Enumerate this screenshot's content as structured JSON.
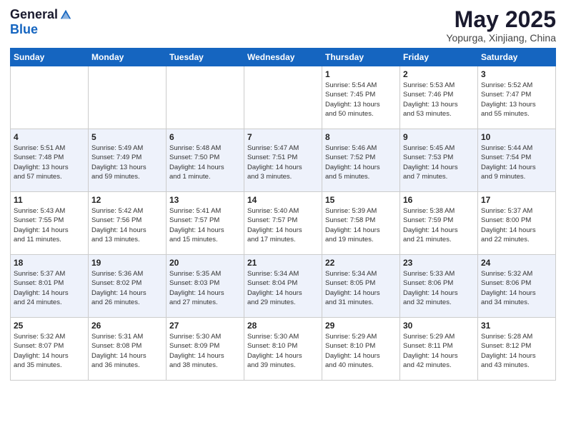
{
  "logo": {
    "general": "General",
    "blue": "Blue"
  },
  "title": "May 2025",
  "location": "Yopurga, Xinjiang, China",
  "days_of_week": [
    "Sunday",
    "Monday",
    "Tuesday",
    "Wednesday",
    "Thursday",
    "Friday",
    "Saturday"
  ],
  "weeks": [
    [
      {
        "day": "",
        "info": ""
      },
      {
        "day": "",
        "info": ""
      },
      {
        "day": "",
        "info": ""
      },
      {
        "day": "",
        "info": ""
      },
      {
        "day": "1",
        "info": "Sunrise: 5:54 AM\nSunset: 7:45 PM\nDaylight: 13 hours\nand 50 minutes."
      },
      {
        "day": "2",
        "info": "Sunrise: 5:53 AM\nSunset: 7:46 PM\nDaylight: 13 hours\nand 53 minutes."
      },
      {
        "day": "3",
        "info": "Sunrise: 5:52 AM\nSunset: 7:47 PM\nDaylight: 13 hours\nand 55 minutes."
      }
    ],
    [
      {
        "day": "4",
        "info": "Sunrise: 5:51 AM\nSunset: 7:48 PM\nDaylight: 13 hours\nand 57 minutes."
      },
      {
        "day": "5",
        "info": "Sunrise: 5:49 AM\nSunset: 7:49 PM\nDaylight: 13 hours\nand 59 minutes."
      },
      {
        "day": "6",
        "info": "Sunrise: 5:48 AM\nSunset: 7:50 PM\nDaylight: 14 hours\nand 1 minute."
      },
      {
        "day": "7",
        "info": "Sunrise: 5:47 AM\nSunset: 7:51 PM\nDaylight: 14 hours\nand 3 minutes."
      },
      {
        "day": "8",
        "info": "Sunrise: 5:46 AM\nSunset: 7:52 PM\nDaylight: 14 hours\nand 5 minutes."
      },
      {
        "day": "9",
        "info": "Sunrise: 5:45 AM\nSunset: 7:53 PM\nDaylight: 14 hours\nand 7 minutes."
      },
      {
        "day": "10",
        "info": "Sunrise: 5:44 AM\nSunset: 7:54 PM\nDaylight: 14 hours\nand 9 minutes."
      }
    ],
    [
      {
        "day": "11",
        "info": "Sunrise: 5:43 AM\nSunset: 7:55 PM\nDaylight: 14 hours\nand 11 minutes."
      },
      {
        "day": "12",
        "info": "Sunrise: 5:42 AM\nSunset: 7:56 PM\nDaylight: 14 hours\nand 13 minutes."
      },
      {
        "day": "13",
        "info": "Sunrise: 5:41 AM\nSunset: 7:57 PM\nDaylight: 14 hours\nand 15 minutes."
      },
      {
        "day": "14",
        "info": "Sunrise: 5:40 AM\nSunset: 7:57 PM\nDaylight: 14 hours\nand 17 minutes."
      },
      {
        "day": "15",
        "info": "Sunrise: 5:39 AM\nSunset: 7:58 PM\nDaylight: 14 hours\nand 19 minutes."
      },
      {
        "day": "16",
        "info": "Sunrise: 5:38 AM\nSunset: 7:59 PM\nDaylight: 14 hours\nand 21 minutes."
      },
      {
        "day": "17",
        "info": "Sunrise: 5:37 AM\nSunset: 8:00 PM\nDaylight: 14 hours\nand 22 minutes."
      }
    ],
    [
      {
        "day": "18",
        "info": "Sunrise: 5:37 AM\nSunset: 8:01 PM\nDaylight: 14 hours\nand 24 minutes."
      },
      {
        "day": "19",
        "info": "Sunrise: 5:36 AM\nSunset: 8:02 PM\nDaylight: 14 hours\nand 26 minutes."
      },
      {
        "day": "20",
        "info": "Sunrise: 5:35 AM\nSunset: 8:03 PM\nDaylight: 14 hours\nand 27 minutes."
      },
      {
        "day": "21",
        "info": "Sunrise: 5:34 AM\nSunset: 8:04 PM\nDaylight: 14 hours\nand 29 minutes."
      },
      {
        "day": "22",
        "info": "Sunrise: 5:34 AM\nSunset: 8:05 PM\nDaylight: 14 hours\nand 31 minutes."
      },
      {
        "day": "23",
        "info": "Sunrise: 5:33 AM\nSunset: 8:06 PM\nDaylight: 14 hours\nand 32 minutes."
      },
      {
        "day": "24",
        "info": "Sunrise: 5:32 AM\nSunset: 8:06 PM\nDaylight: 14 hours\nand 34 minutes."
      }
    ],
    [
      {
        "day": "25",
        "info": "Sunrise: 5:32 AM\nSunset: 8:07 PM\nDaylight: 14 hours\nand 35 minutes."
      },
      {
        "day": "26",
        "info": "Sunrise: 5:31 AM\nSunset: 8:08 PM\nDaylight: 14 hours\nand 36 minutes."
      },
      {
        "day": "27",
        "info": "Sunrise: 5:30 AM\nSunset: 8:09 PM\nDaylight: 14 hours\nand 38 minutes."
      },
      {
        "day": "28",
        "info": "Sunrise: 5:30 AM\nSunset: 8:10 PM\nDaylight: 14 hours\nand 39 minutes."
      },
      {
        "day": "29",
        "info": "Sunrise: 5:29 AM\nSunset: 8:10 PM\nDaylight: 14 hours\nand 40 minutes."
      },
      {
        "day": "30",
        "info": "Sunrise: 5:29 AM\nSunset: 8:11 PM\nDaylight: 14 hours\nand 42 minutes."
      },
      {
        "day": "31",
        "info": "Sunrise: 5:28 AM\nSunset: 8:12 PM\nDaylight: 14 hours\nand 43 minutes."
      }
    ]
  ]
}
